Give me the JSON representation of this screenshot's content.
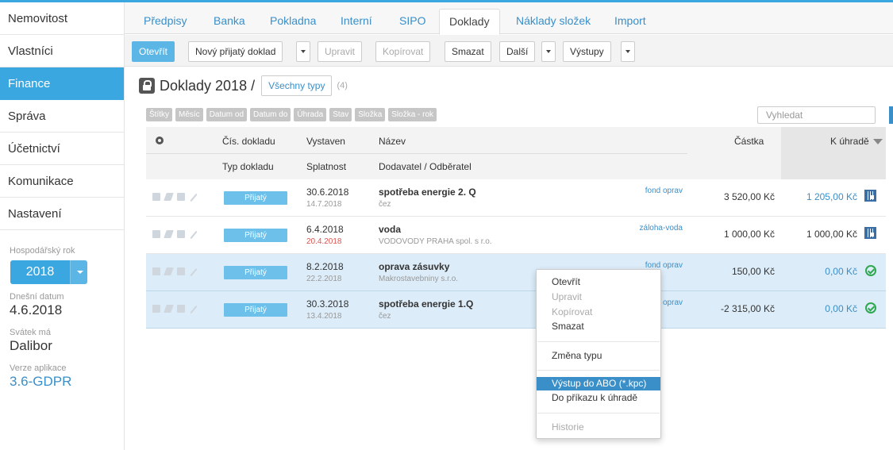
{
  "sidebar": {
    "nav": [
      "Nemovitost",
      "Vlastníci",
      "Finance",
      "Správa",
      "Účetnictví",
      "Komunikace",
      "Nastavení"
    ],
    "fiscal_year_label": "Hospodářský rok",
    "fiscal_year": "2018",
    "today_label": "Dnešní datum",
    "today": "4.6.2018",
    "nameday_label": "Svátek má",
    "nameday": "Dalibor",
    "version_label": "Verze aplikace",
    "version": "3.6-GDPR"
  },
  "tabs": [
    "Předpisy",
    "Banka",
    "Pokladna",
    "Interní",
    "SIPO",
    "Doklady",
    "Náklady složek",
    "Import"
  ],
  "toolbar": {
    "open": "Otevřít",
    "new_received": "Nový přijatý doklad",
    "edit": "Upravit",
    "copy": "Kopírovat",
    "delete": "Smazat",
    "more": "Další",
    "outputs": "Výstupy"
  },
  "heading": {
    "title": "Doklady 2018 /",
    "type_filter": "Všechny typy",
    "count": "(4)"
  },
  "filters": [
    "Štítky",
    "Měsíc",
    "Datum od",
    "Datum do",
    "Úhrada",
    "Stav",
    "Složka",
    "Složka - rok"
  ],
  "search": {
    "placeholder": "Vyhledat"
  },
  "columns": {
    "doc_no": "Čís. dokladu",
    "issued": "Vystaven",
    "name": "Název",
    "amount": "Částka",
    "to_pay": "K úhradě",
    "doc_type": "Typ dokladu",
    "due": "Splatnost",
    "party": "Dodavatel / Odběratel"
  },
  "rows": [
    {
      "type": "Přijatý",
      "issued": "30.6.2018",
      "due": "14.7.2018",
      "name": "spotřeba energie 2. Q",
      "party": "čez",
      "tag": "fond oprav",
      "amount": "3 520,00 Kč",
      "to_pay": "1 205,00 Kč"
    },
    {
      "type": "Přijatý",
      "issued": "6.4.2018",
      "due": "20.4.2018",
      "name": "voda",
      "party": "VODOVODY PRAHA spol. s r.o.",
      "tag": "záloha-voda",
      "amount": "1 000,00 Kč",
      "to_pay": "1 000,00 Kč"
    },
    {
      "type": "Přijatý",
      "issued": "8.2.2018",
      "due": "22.2.2018",
      "name": "oprava zásuvky",
      "party": "Makrostavebniny s.r.o.",
      "tag": "fond oprav",
      "amount": "150,00 Kč",
      "to_pay": "0,00 Kč"
    },
    {
      "type": "Přijatý",
      "issued": "30.3.2018",
      "due": "13.4.2018",
      "name": "spotřeba energie 1.Q",
      "party": "čez",
      "tag": "oprav",
      "amount": "-2 315,00 Kč",
      "to_pay": "0,00 Kč"
    }
  ],
  "context_menu": {
    "open": "Otevřít",
    "edit": "Upravit",
    "copy": "Kopírovat",
    "delete": "Smazat",
    "change_type": "Změna typu",
    "abo_export": "Výstup do ABO (*.kpc)",
    "payment_order": "Do příkazu k úhradě",
    "history": "Historie"
  },
  "colors": {
    "accent": "#3aa7e0",
    "link": "#3a8fc8",
    "selected_row": "#dcecf8",
    "ok": "#2fa84f"
  }
}
